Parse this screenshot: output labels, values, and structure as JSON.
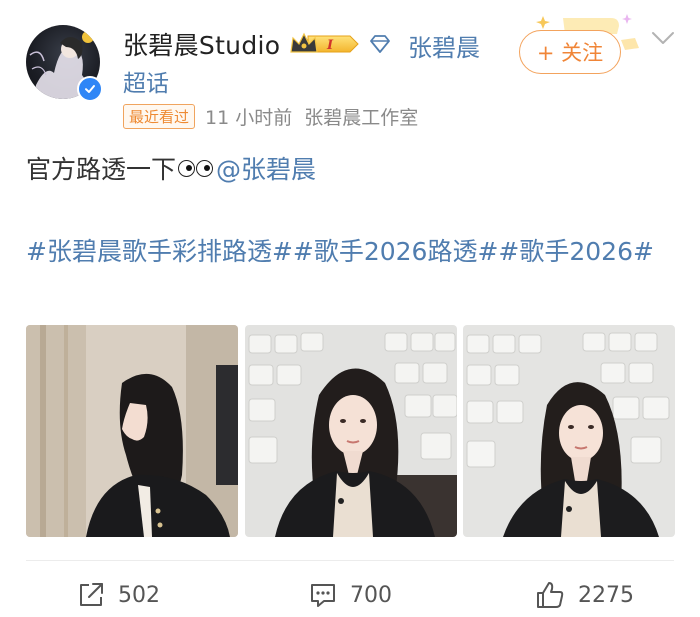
{
  "post": {
    "user_name": "张碧晨Studio",
    "vip_level": "I",
    "supertopic_line1": "张碧晨",
    "supertopic_line2": "超话",
    "follow_label": "+ 关注",
    "recent_badge": "最近看过",
    "time": "11 小时前",
    "source": "张碧晨工作室",
    "text": "官方路透一下",
    "mention": "@张碧晨",
    "hashtags": "#张碧晨歌手彩排路透##歌手2026路透##歌手2026#"
  },
  "photos": [
    {
      "name": "photo-1"
    },
    {
      "name": "photo-2"
    },
    {
      "name": "photo-3"
    }
  ],
  "actions": {
    "repost_count": "502",
    "comment_count": "700",
    "like_count": "2275"
  },
  "icons": {
    "verify": "verified-check-icon",
    "crown": "crown-vip-icon",
    "diamond": "diamond-icon",
    "chevron": "chevron-down-icon",
    "repost": "repost-icon",
    "comment": "comment-icon",
    "like": "thumbs-up-icon"
  },
  "colors": {
    "link": "#507daf",
    "follow_orange": "#f08537",
    "text": "#333333",
    "meta": "#8a8a8a"
  }
}
